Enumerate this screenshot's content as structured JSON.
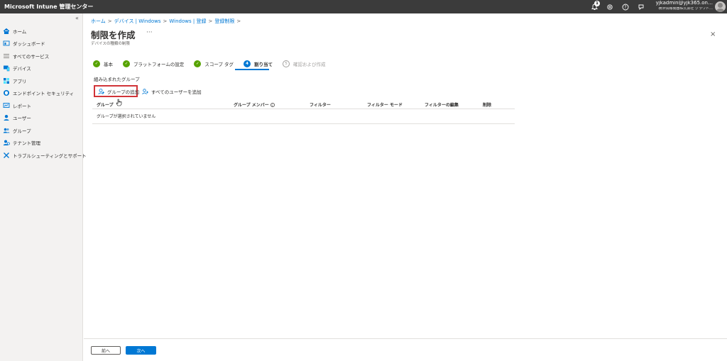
{
  "app": {
    "title": "Microsoft Intune 管理センター"
  },
  "account": {
    "user": "yjkadmin@yjk365.on…",
    "org": "横浜情報機器株式会社 グラウド…",
    "notification_count": "1"
  },
  "sidebar": {
    "collapse_glyph": "«",
    "items": [
      {
        "label": "ホーム",
        "icon": "home-icon"
      },
      {
        "label": "ダッシュボード",
        "icon": "dashboard-icon"
      },
      {
        "label": "すべてのサービス",
        "icon": "list-icon"
      },
      {
        "label": "デバイス",
        "icon": "devices-icon"
      },
      {
        "label": "アプリ",
        "icon": "apps-icon"
      },
      {
        "label": "エンドポイント セキュリティ",
        "icon": "shield-icon"
      },
      {
        "label": "レポート",
        "icon": "report-icon"
      },
      {
        "label": "ユーザー",
        "icon": "user-icon"
      },
      {
        "label": "グループ",
        "icon": "group-icon"
      },
      {
        "label": "テナント管理",
        "icon": "tenant-icon"
      },
      {
        "label": "トラブルシューティングとサポート",
        "icon": "tools-icon"
      }
    ]
  },
  "breadcrumb": [
    "ホーム",
    "デバイス | Windows",
    "Windows | 登録",
    "登録制限"
  ],
  "page": {
    "title": "制限を作成",
    "subtitle": "デバイスの種類の制限",
    "more": "···",
    "close": "×"
  },
  "steps": [
    {
      "label": "基本",
      "state": "done",
      "marker": "✓"
    },
    {
      "label": "プラットフォームの設定",
      "state": "done",
      "marker": "✓"
    },
    {
      "label": "スコープ タグ",
      "state": "done",
      "marker": "✓"
    },
    {
      "label": "割り当て",
      "state": "active",
      "marker": "4"
    },
    {
      "label": "確認および作成",
      "state": "pending",
      "marker": "5"
    }
  ],
  "assignments": {
    "section_title": "組み込まれたグループ",
    "add_group": "グループの追加",
    "add_all_users": "すべてのユーザーを追加"
  },
  "table": {
    "columns": [
      "グループ",
      "グループ メンバー",
      "フィルター",
      "フィルター モード",
      "フィルターの編集",
      "削除"
    ],
    "info_glyph": "i",
    "empty": "グループが選択されていません"
  },
  "footer": {
    "prev": "前へ",
    "next": "次へ"
  },
  "colors": {
    "accent": "#0078d4",
    "success": "#57a300",
    "highlight": "#d13438",
    "topbar": "#3b3b3b"
  }
}
